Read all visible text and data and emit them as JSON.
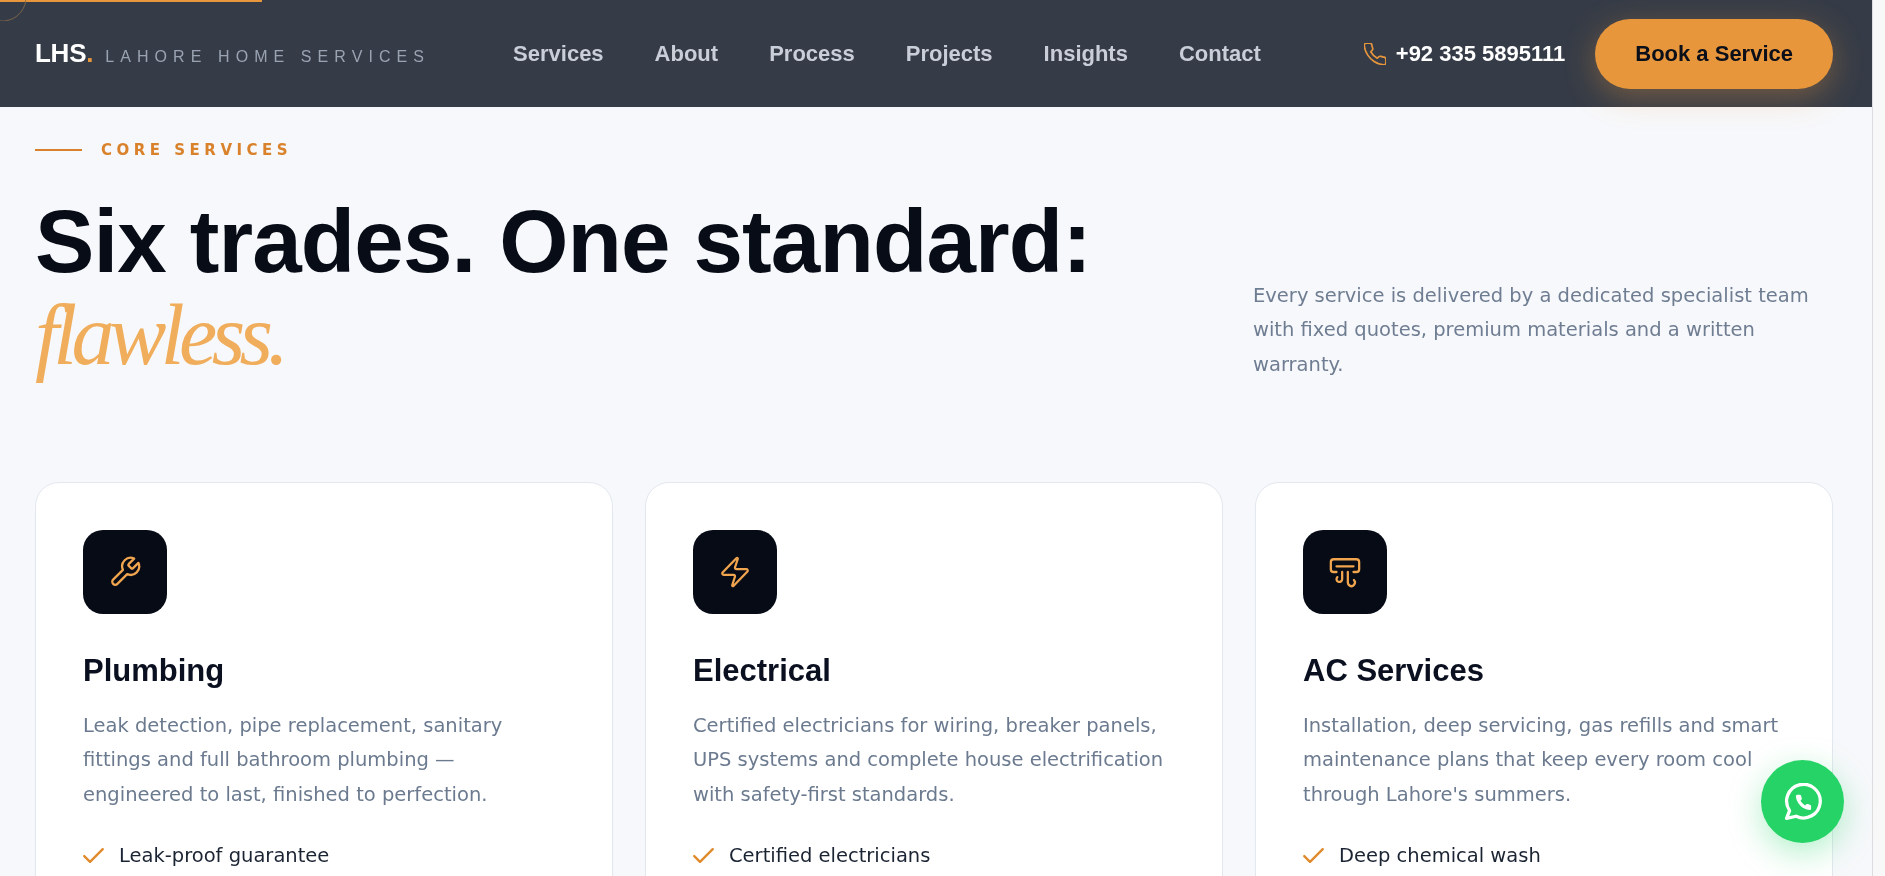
{
  "header": {
    "scroll_progress": {
      "level": 0.14
    },
    "logo": {
      "mark": "LHS",
      "dot": ".",
      "name": "LAHORE HOME SERVICES"
    },
    "nav": [
      {
        "label": "Services"
      },
      {
        "label": "About"
      },
      {
        "label": "Process"
      },
      {
        "label": "Projects"
      },
      {
        "label": "Insights"
      },
      {
        "label": "Contact"
      }
    ],
    "phone": "+92 335 5895111",
    "cta": "Book a Service"
  },
  "section": {
    "eyebrow": "CORE SERVICES",
    "heading": "Six trades. One standard: *flawless.*",
    "intro": "Every service is delivered by a dedicated specialist team with fixed quotes, premium materials and a written warranty."
  },
  "services": [
    {
      "kind": "plumbing",
      "title": "Plumbing",
      "description": "Leak detection, pipe replacement, sanitary fittings and full bathroom plumbing — engineered to last, finished to perfection.",
      "features": [
        "Leak-proof guarantee"
      ]
    },
    {
      "kind": "electrical",
      "title": "Electrical",
      "description": "Certified electricians for wiring, breaker panels, UPS systems and complete house electrification with safety-first standards.",
      "features": [
        "Certified electricians"
      ]
    },
    {
      "kind": "cooling",
      "title": "AC Services",
      "description": "Installation, deep servicing, gas refills and smart maintenance plans that keep every room cool through Lahore's summers.",
      "features": [
        "Deep chemical wash"
      ]
    }
  ]
}
